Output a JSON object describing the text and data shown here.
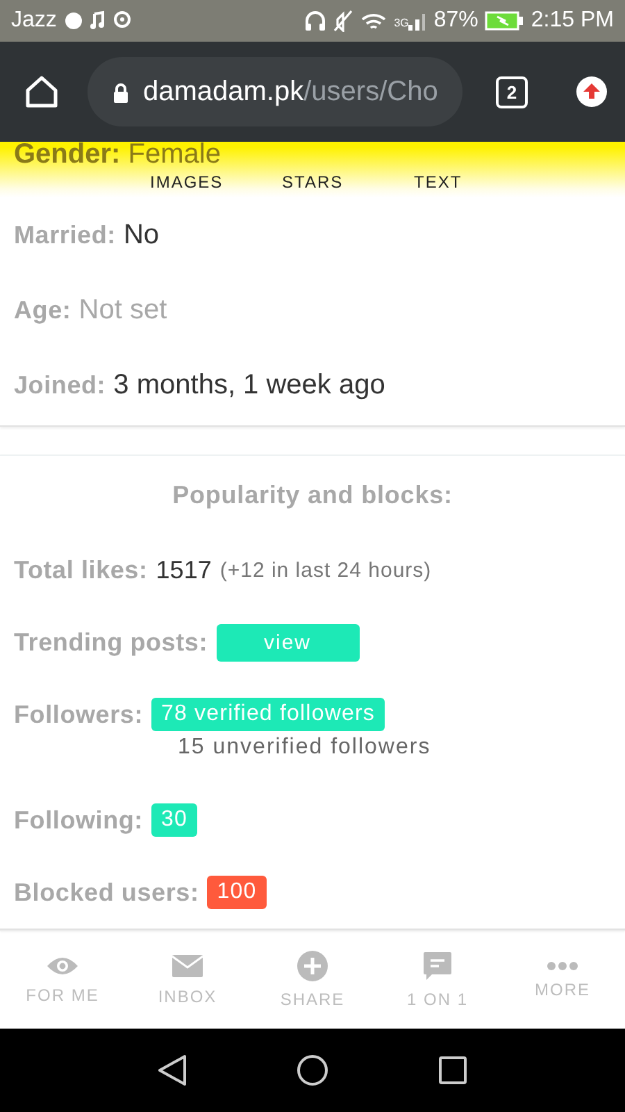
{
  "status_bar": {
    "carrier": "Jazz",
    "network": "3G",
    "battery": "87%",
    "time": "2:15 PM"
  },
  "browser": {
    "url_host": "damadam.pk",
    "url_path": "/users/Cho",
    "tab_count": "2"
  },
  "tabs": [
    {
      "label": "IMAGES"
    },
    {
      "label": "STARS"
    },
    {
      "label": "TEXT"
    }
  ],
  "gender": {
    "label": "Gender:",
    "value": "Female"
  },
  "profile": [
    {
      "label": "Married:",
      "value": "No",
      "muted": false
    },
    {
      "label": "Age:",
      "value": "Not set",
      "muted": true
    },
    {
      "label": "Joined:",
      "value": "3 months, 1 week ago",
      "muted": false
    }
  ],
  "popularity": {
    "title": "Popularity and blocks:",
    "total_likes": {
      "label": "Total likes:",
      "value": "1517",
      "note": "(+12 in last 24 hours)"
    },
    "trending": {
      "label": "Trending posts:",
      "button": "view"
    },
    "followers": {
      "label": "Followers:",
      "verified": "78 verified followers",
      "unverified": "15 unverified followers"
    },
    "following": {
      "label": "Following:",
      "count": "30",
      "color": "#1de9b6"
    },
    "blocked": {
      "label": "Blocked users:",
      "count": "100",
      "color": "#ff5a3c"
    }
  },
  "bottom_nav": [
    {
      "label": "FOR ME",
      "kind": "eye"
    },
    {
      "label": "INBOX",
      "kind": "mail"
    },
    {
      "label": "SHARE",
      "kind": "add"
    },
    {
      "label": "1 ON 1",
      "kind": "chat"
    },
    {
      "label": "MORE",
      "kind": "more"
    }
  ]
}
